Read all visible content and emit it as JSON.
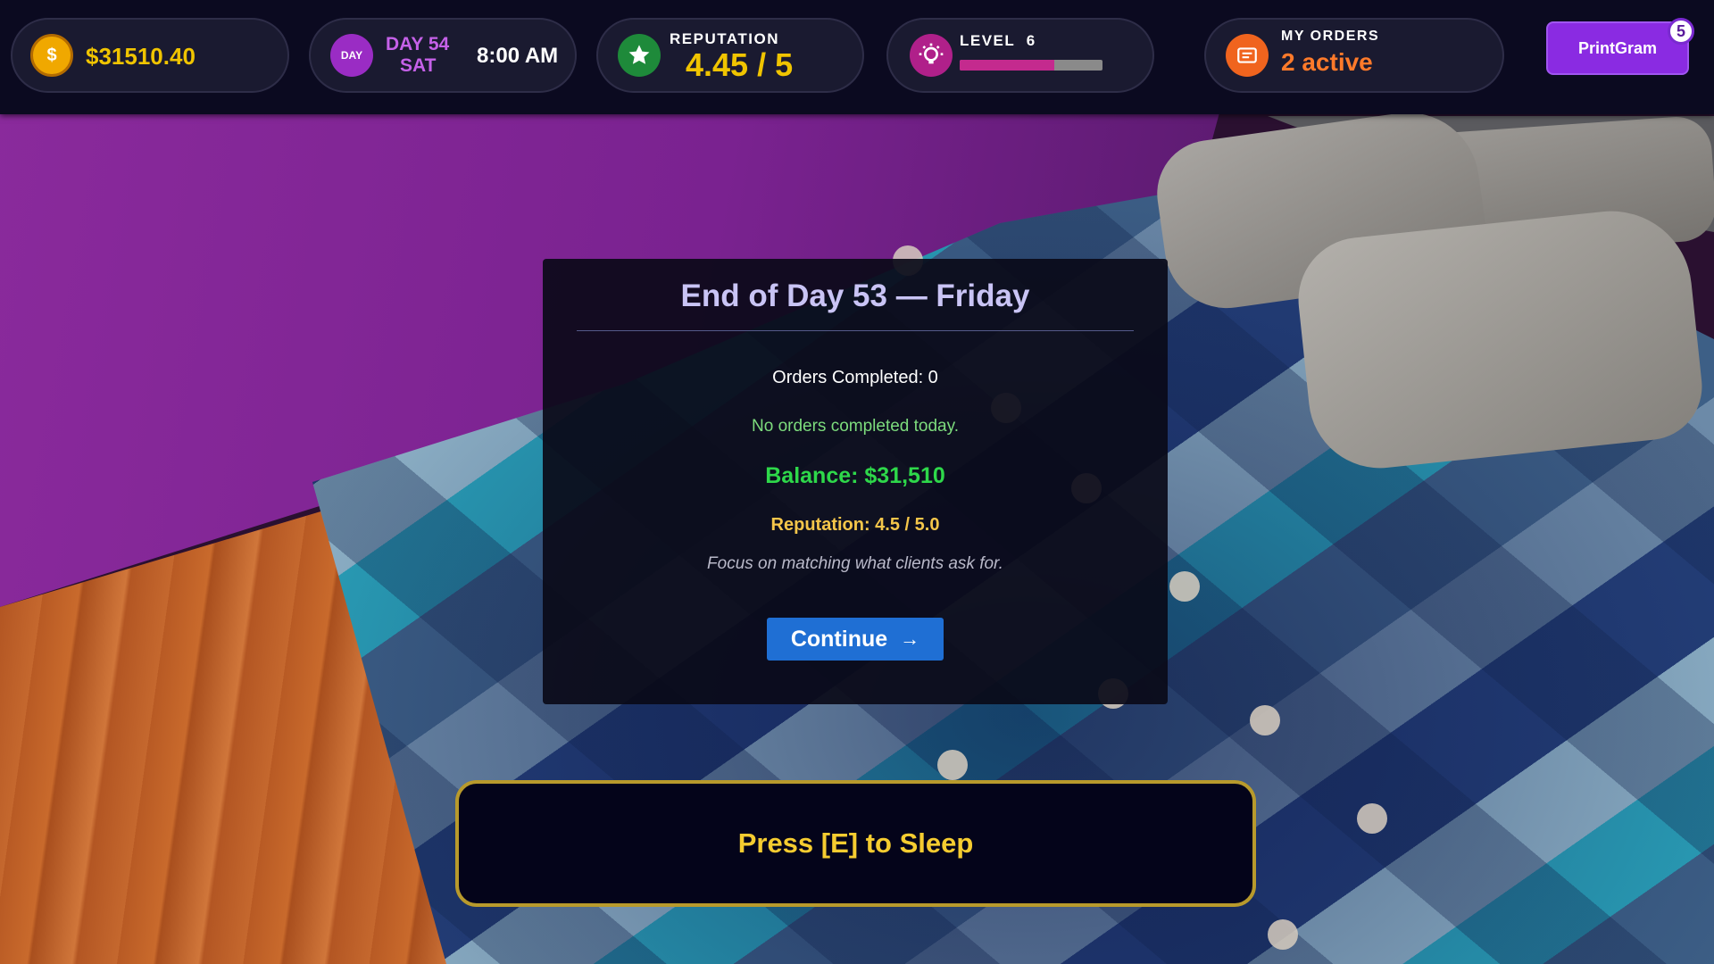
{
  "hud": {
    "money": "$31510.40",
    "money_icon_glyph": "$",
    "day_icon_label": "DAY",
    "day_number": "DAY 54",
    "weekday": "SAT",
    "time": "8:00 AM",
    "reputation_caption": "REPUTATION",
    "reputation_value": "4.45 / 5",
    "level_caption": "LEVEL",
    "level_number": "6",
    "level_progress_fraction": 0.66,
    "orders_caption": "MY ORDERS",
    "orders_value": "2 active",
    "printgram_label": "PrintGram",
    "printgram_badge": "5",
    "colors": {
      "money": "#f0c400",
      "day": "#c561e8",
      "reputation": "#f0c400",
      "level_bar": "#c42a8e",
      "orders": "#ff7a2a",
      "printgram": "#8a2be2"
    }
  },
  "modal": {
    "title": "End of Day 53 — Friday",
    "orders_completed": "Orders Completed: 0",
    "no_orders_note": "No orders completed today.",
    "balance": "Balance: $31,510",
    "reputation": "Reputation: 4.5 / 5.0",
    "tip": "Focus on matching what clients ask for.",
    "continue_label": "Continue",
    "continue_arrow": "→"
  },
  "prompt": {
    "sleep_text": "Press [E] to Sleep"
  },
  "icons": {
    "money": "dollar-coin-icon",
    "day": "day-icon",
    "reputation": "star-icon",
    "level": "lightbulb-icon",
    "orders": "order-card-icon"
  }
}
